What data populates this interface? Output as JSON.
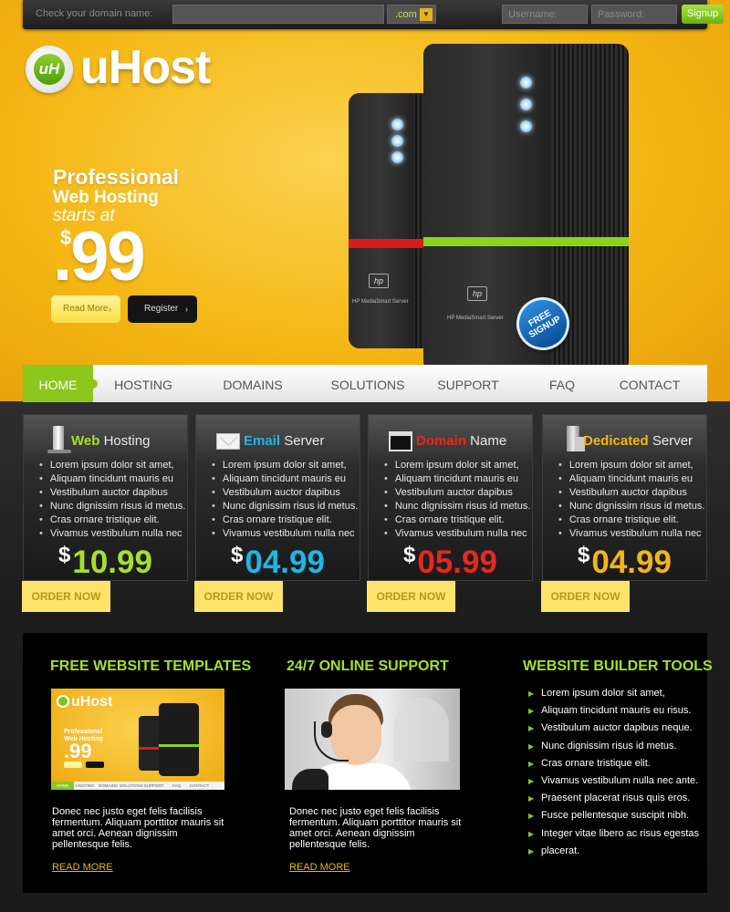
{
  "topbar": {
    "domain_label": "Check your domain name:",
    "tld_value": ".com",
    "username_placeholder": "Username:",
    "password_placeholder": "Password:",
    "signup_label": "Signup"
  },
  "hero": {
    "logo_mark": "uH",
    "logo_text": "uHost",
    "headline_1": "Professional",
    "headline_2": "Web Hosting",
    "headline_3": "starts at",
    "currency": "$",
    "price": ".99",
    "read_more": "Read More",
    "register": "Register",
    "server_brand": "hp",
    "server_model": "HP MediaSmart Server",
    "badge": "FREE SIGNUP"
  },
  "nav": {
    "items": [
      "HOME",
      "HOSTING",
      "DOMAINS",
      "SOLUTIONS",
      "SUPPORT",
      "FAQ",
      "CONTACT"
    ],
    "active": "HOME",
    "accent": "#8cc71d"
  },
  "plans": [
    {
      "title_highlight": "Web",
      "title_rest": " Hosting",
      "color": "#a6df2d",
      "icon": "server-tower-icon",
      "features": [
        "Lorem ipsum dolor sit amet,",
        "Aliquam tincidunt mauris eu",
        "Vestibulum auctor dapibus",
        "Nunc dignissim risus id metus.",
        "Cras ornare tristique elit.",
        "Vivamus vestibulum nulla nec"
      ],
      "price": "10.99",
      "order": "ORDER NOW"
    },
    {
      "title_highlight": "Email",
      "title_rest": " Server",
      "color": "#1fb6e6",
      "icon": "envelope-icon",
      "features": [
        "Lorem ipsum dolor sit amet,",
        "Aliquam tincidunt mauris eu",
        "Vestibulum auctor dapibus",
        "Nunc dignissim risus id metus.",
        "Cras ornare tristique elit.",
        "Vivamus vestibulum nulla nec"
      ],
      "price": "04.99",
      "order": "ORDER NOW"
    },
    {
      "title_highlight": "Domain",
      "title_rest": " Name",
      "color": "#e8281c",
      "icon": "browser-window-icon",
      "features": [
        "Lorem ipsum dolor sit amet,",
        "Aliquam tincidunt mauris eu",
        "Vestibulum auctor dapibus",
        "Nunc dignissim risus id metus.",
        "Cras ornare tristique elit.",
        "Vivamus vestibulum nulla nec"
      ],
      "price": "05.99",
      "order": "ORDER NOW"
    },
    {
      "title_highlight": "Dedicated",
      "title_rest": " Server",
      "color": "#f1b51a",
      "icon": "dedicated-server-icon",
      "features": [
        "Lorem ipsum dolor sit amet,",
        "Aliquam tincidunt mauris eu",
        "Vestibulum auctor dapibus",
        "Nunc dignissim risus id metus.",
        "Cras ornare tristique elit.",
        "Vivamus vestibulum nulla nec"
      ],
      "price": "04.99",
      "order": "ORDER NOW"
    }
  ],
  "bottom": {
    "templates": {
      "title": "FREE WEBSITE TEMPLATES",
      "text": "Donec nec justo eget felis facilisis fermentum. Aliquam porttitor mauris sit amet orci. Aenean dignissim pellentesque felis.",
      "link": "READ MORE",
      "mini_logo": "uHost",
      "mini_headline": "Professional Web Hosting",
      "mini_price": ".99",
      "mini_nav": [
        "HOME",
        "HOSTING",
        "DOMAINS",
        "SOLUTIONS",
        "SUPPORT",
        "FAQ",
        "CONTACT"
      ]
    },
    "support": {
      "title": "24/7 ONLINE SUPPORT",
      "text": "Donec nec justo eget felis facilisis fermentum. Aliquam porttitor mauris sit amet orci. Aenean dignissim pellentesque felis.",
      "link": "READ MORE"
    },
    "tools": {
      "title": "WEBSITE BUILDER TOOLS",
      "items": [
        "Lorem ipsum dolor sit amet,",
        "Aliquam tincidunt mauris eu risus.",
        "Vestibulum auctor dapibus neque.",
        "Nunc dignissim risus id metus.",
        "Cras ornare tristique elit.",
        "Vivamus vestibulum nulla nec ante.",
        "Praesent placerat risus quis eros.",
        "Fusce pellentesque suscipit nibh.",
        "Integer vitae libero ac risus egestas",
        "placerat."
      ]
    }
  }
}
